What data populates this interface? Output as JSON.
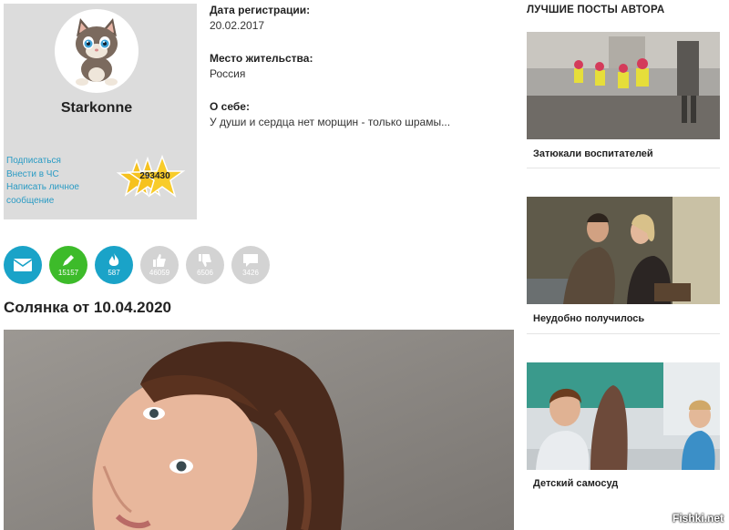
{
  "profile": {
    "username": "Starkonne",
    "links": [
      "Подписаться",
      "Внести в ЧС",
      "Написать личное сообщение"
    ],
    "rating": "293430",
    "avatar_icon": "cat-avatar-icon"
  },
  "info": {
    "reg_label": "Дата регистрации:",
    "reg_value": "20.02.2017",
    "loc_label": "Место жительства:",
    "loc_value": "Россия",
    "about_label": "О себе:",
    "about_value": "У души и сердца нет морщин - только шрамы..."
  },
  "stats": [
    {
      "icon": "mail-icon",
      "value": "",
      "color": "#1aa3c8"
    },
    {
      "icon": "pen-icon",
      "value": "15157",
      "color": "#3dbb2a"
    },
    {
      "icon": "flame-icon",
      "value": "587",
      "color": "#1aa3c8"
    },
    {
      "icon": "thumbs-up-icon",
      "value": "46059",
      "color": "#d3d3d3"
    },
    {
      "icon": "thumbs-down-icon",
      "value": "6506",
      "color": "#d3d3d3"
    },
    {
      "icon": "comment-icon",
      "value": "3426",
      "color": "#d3d3d3"
    }
  ],
  "post": {
    "title": "Солянка от 10.04.2020"
  },
  "sidebar": {
    "heading": "ЛУЧШИЕ ПОСТЫ АВТОРА",
    "posts": [
      {
        "caption": "Затюкали воспитателей"
      },
      {
        "caption": "Неудобно получилось"
      },
      {
        "caption": "Детский самосуд"
      }
    ]
  },
  "watermark": "Fishki.net"
}
